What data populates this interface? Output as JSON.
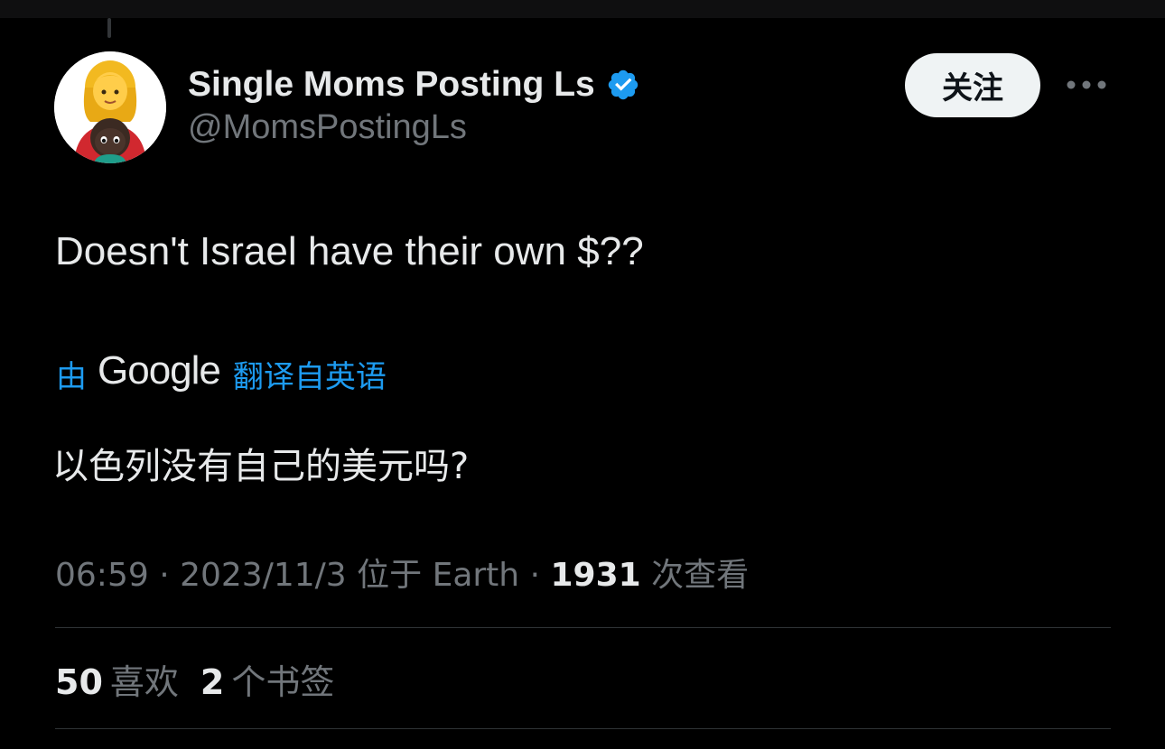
{
  "author": {
    "display_name": "Single Moms Posting Ls",
    "handle": "@MomsPostingLs",
    "verified_color": "#1d9bf0"
  },
  "follow_button": {
    "label": "关注"
  },
  "more_button": {
    "icon": "more-horizontal-icon"
  },
  "tweet": {
    "text": "Doesn't Israel have their own $??"
  },
  "translation": {
    "by_label": "由",
    "provider": "Google",
    "from_label": "翻译自英语",
    "text": "以色列没有自己的美元吗?"
  },
  "meta": {
    "time": "06:59",
    "sep1": " · ",
    "date": "2023/11/3",
    "location": " 位于 Earth",
    "sep2": " · ",
    "views_count": "1931",
    "views_label": " 次查看"
  },
  "stats": {
    "likes_count": "50",
    "likes_label": "喜欢",
    "bookmarks_count": "2",
    "bookmarks_label": "个书签"
  },
  "colors": {
    "background": "#000000",
    "text_primary": "#e7e9ea",
    "text_secondary": "#71767b",
    "accent": "#1d9bf0",
    "divider": "#2f3336"
  }
}
